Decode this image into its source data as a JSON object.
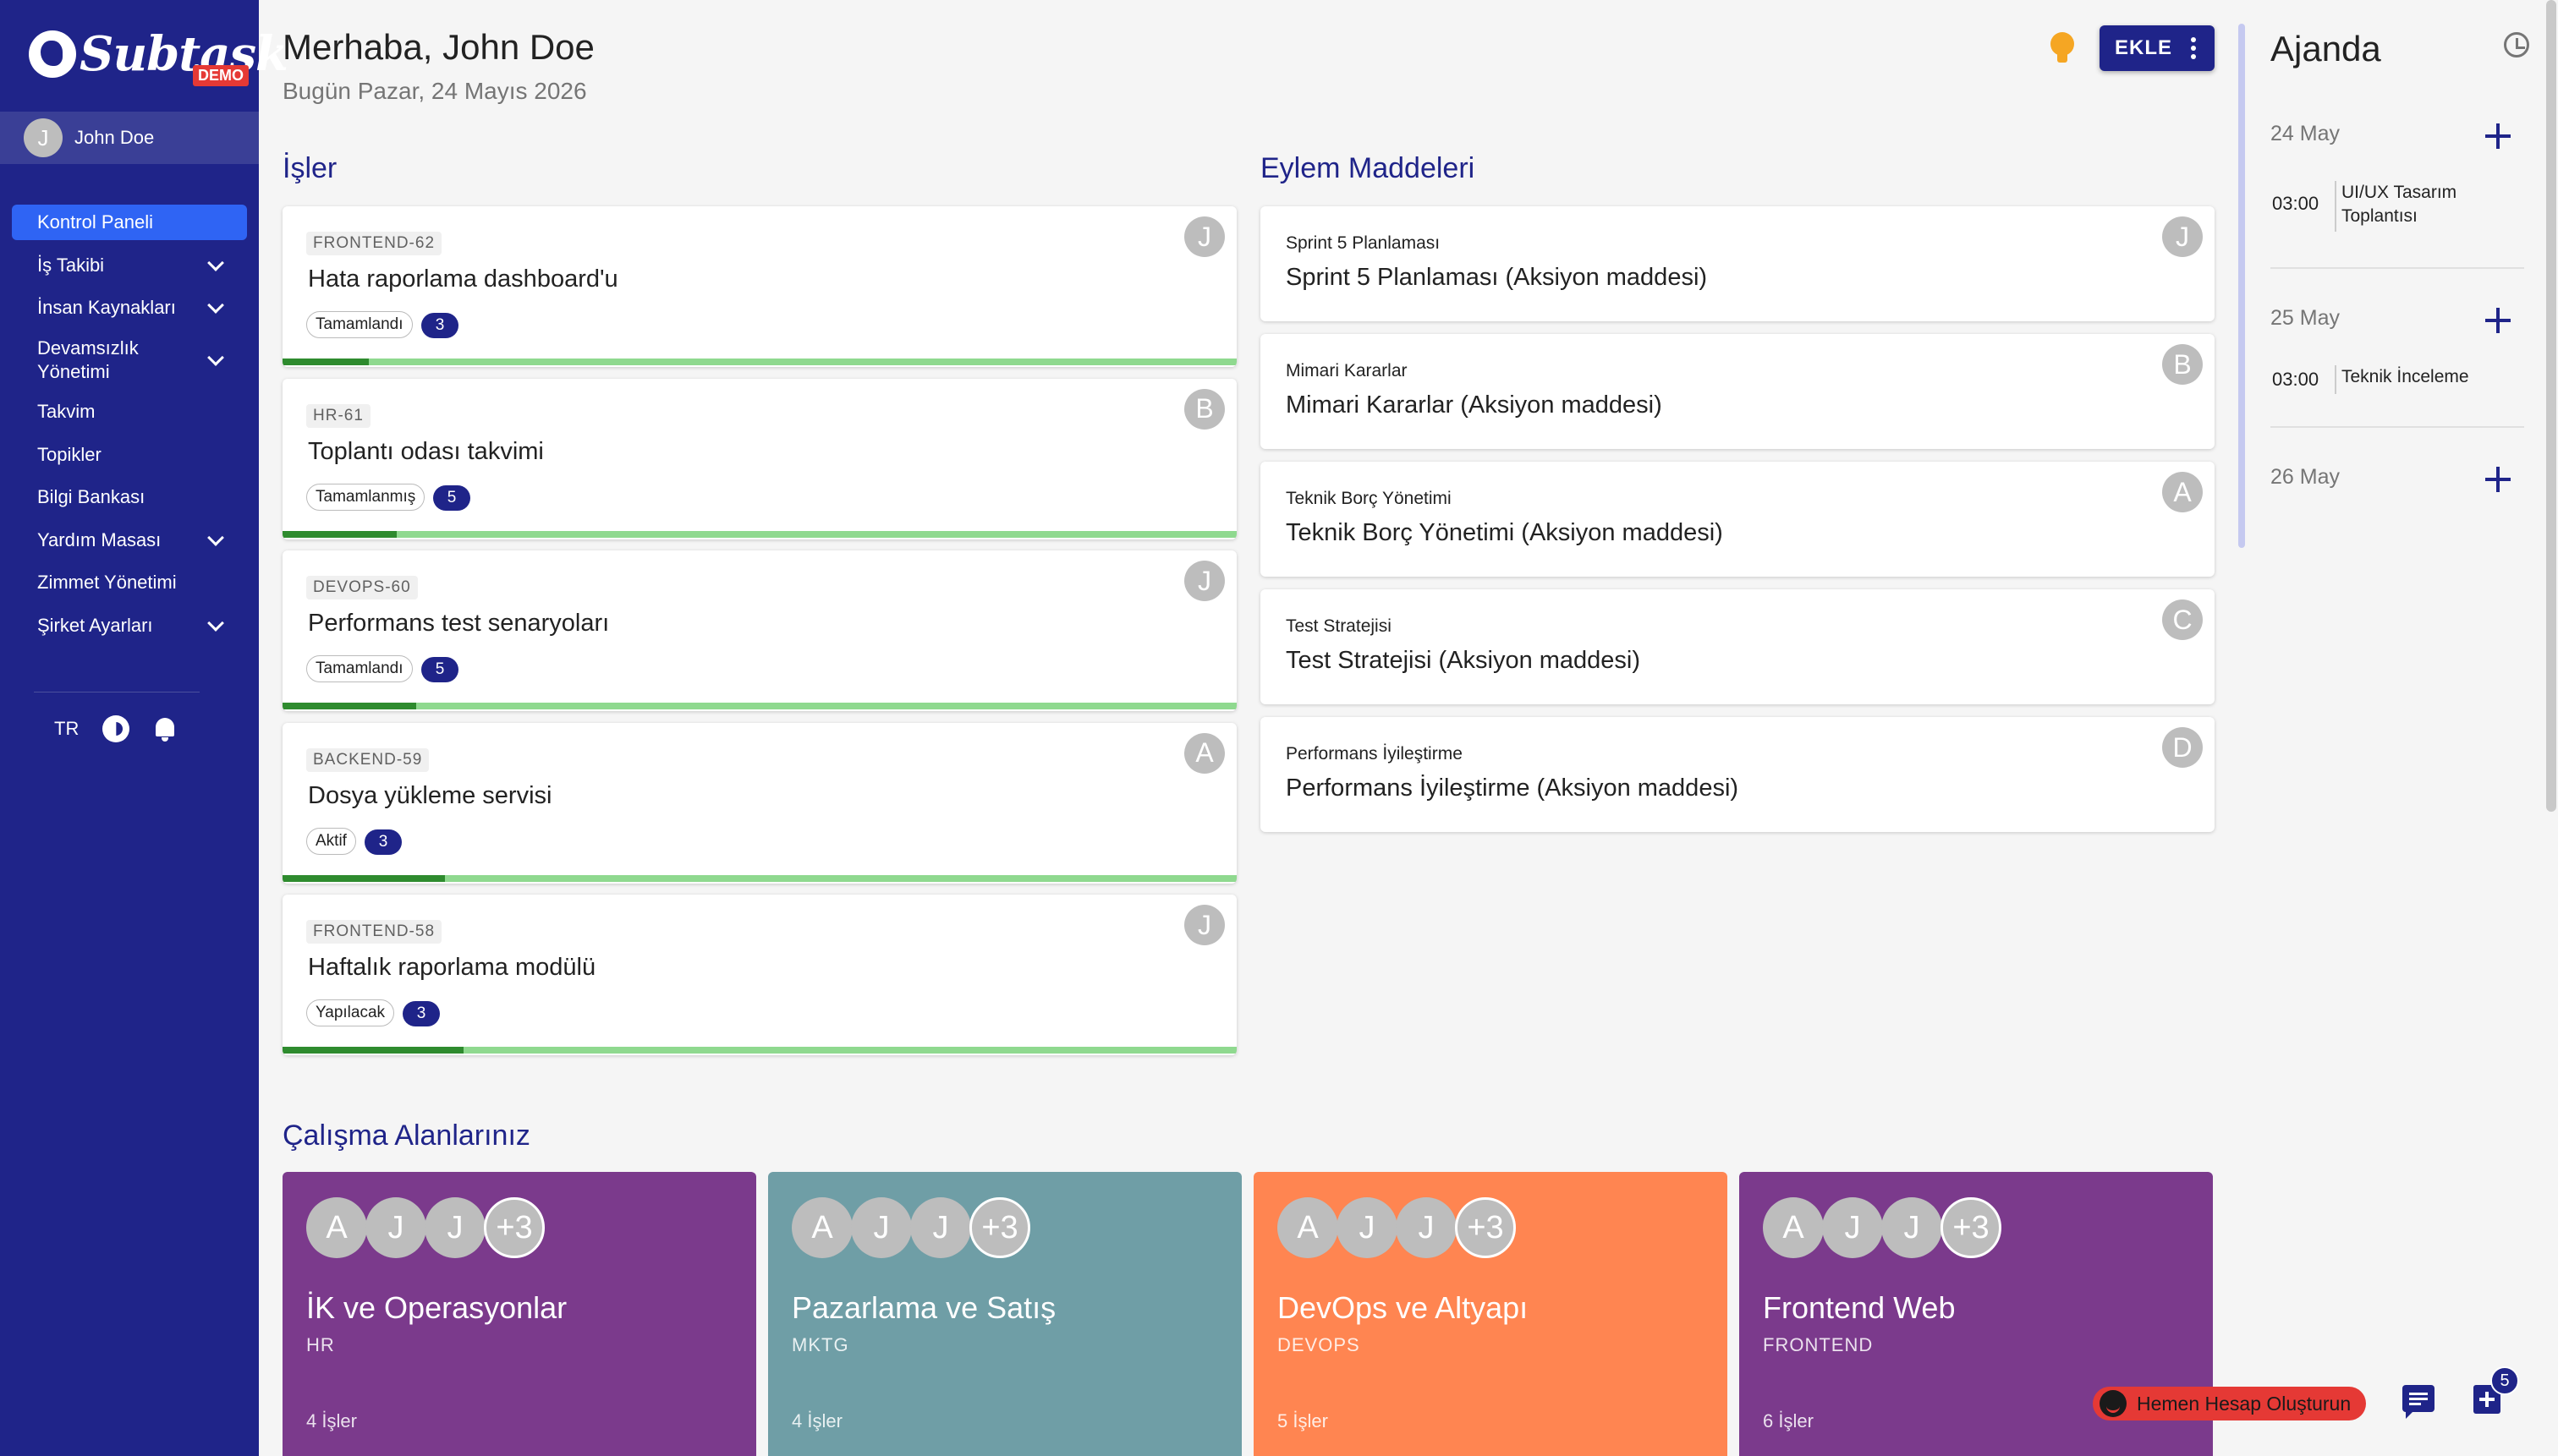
{
  "app": {
    "logo_text": "Subtask",
    "demo_badge": "DEMO"
  },
  "user": {
    "initial": "J",
    "name": "John Doe"
  },
  "sidebar": {
    "items": [
      {
        "label": "Kontrol Paneli",
        "active": true,
        "expandable": false
      },
      {
        "label": "İş Takibi",
        "expandable": true
      },
      {
        "label": "İnsan Kaynakları",
        "expandable": true
      },
      {
        "label": "Devamsızlık Yönetimi",
        "expandable": true
      },
      {
        "label": "Takvim",
        "expandable": false
      },
      {
        "label": "Topikler",
        "expandable": false
      },
      {
        "label": "Bilgi Bankası",
        "expandable": false
      },
      {
        "label": "Yardım Masası",
        "expandable": true
      },
      {
        "label": "Zimmet Yönetimi",
        "expandable": false
      },
      {
        "label": "Şirket Ayarları",
        "expandable": true
      }
    ],
    "language": "TR",
    "theme_icon": "brightness-icon",
    "notification_icon": "bell-icon"
  },
  "header": {
    "greeting": "Merhaba, John Doe",
    "date": "Bugün Pazar, 24 Mayıs 2026",
    "add_button": "EKLE",
    "tip_icon": "lightbulb-icon",
    "more_icon": "kebab-menu-icon"
  },
  "tasks": {
    "title": "İşler",
    "items": [
      {
        "code": "FRONTEND-62",
        "title": "Hata raporlama dashboard'u",
        "status": "Tamamlandı",
        "count": "3",
        "assignee": "J",
        "progress": 0.09
      },
      {
        "code": "HR-61",
        "title": "Toplantı odası takvimi",
        "status": "Tamamlanmış",
        "count": "5",
        "assignee": "B",
        "progress": 0.12
      },
      {
        "code": "DEVOPS-60",
        "title": "Performans test senaryoları",
        "status": "Tamamlandı",
        "count": "5",
        "assignee": "J",
        "progress": 0.14
      },
      {
        "code": "BACKEND-59",
        "title": "Dosya yükleme servisi",
        "status": "Aktif",
        "count": "3",
        "assignee": "A",
        "progress": 0.17
      },
      {
        "code": "FRONTEND-58",
        "title": "Haftalık raporlama modülü",
        "status": "Yapılacak",
        "count": "3",
        "assignee": "J",
        "progress": 0.19
      }
    ]
  },
  "actions": {
    "title": "Eylem Maddeleri",
    "items": [
      {
        "subtitle": "Sprint 5 Planlaması",
        "title": "Sprint 5 Planlaması (Aksiyon maddesi)",
        "assignee": "J"
      },
      {
        "subtitle": "Mimari Kararlar",
        "title": "Mimari Kararlar (Aksiyon maddesi)",
        "assignee": "B"
      },
      {
        "subtitle": "Teknik Borç Yönetimi",
        "title": "Teknik Borç Yönetimi (Aksiyon maddesi)",
        "assignee": "A"
      },
      {
        "subtitle": "Test Stratejisi",
        "title": "Test Stratejisi (Aksiyon maddesi)",
        "assignee": "C"
      },
      {
        "subtitle": "Performans İyileştirme",
        "title": "Performans İyileştirme (Aksiyon maddesi)",
        "assignee": "D"
      }
    ]
  },
  "workspaces": {
    "title": "Çalışma Alanlarınız",
    "items": [
      {
        "name": "İK ve Operasyonlar",
        "code": "HR",
        "jobs": "4 İşler",
        "color": "#7b3a8c",
        "members": [
          "A",
          "J",
          "J"
        ],
        "more": "+3"
      },
      {
        "name": "Pazarlama ve Satış",
        "code": "MKTG",
        "jobs": "4 İşler",
        "color": "#6f9ea6",
        "members": [
          "A",
          "J",
          "J"
        ],
        "more": "+3"
      },
      {
        "name": "DevOps ve Altyapı",
        "code": "DEVOPS",
        "jobs": "5 İşler",
        "color": "#ff8551",
        "members": [
          "A",
          "J",
          "J"
        ],
        "more": "+3"
      },
      {
        "name": "Frontend Web",
        "code": "FRONTEND",
        "jobs": "6 İşler",
        "color": "#7b3a8c",
        "members": [
          "A",
          "J",
          "J"
        ],
        "more": "+3"
      }
    ]
  },
  "agenda": {
    "title": "Ajanda",
    "history_icon": "history-icon",
    "days": [
      {
        "date": "24 May",
        "events": [
          {
            "time": "03:00",
            "title": "UI/UX Tasarım Toplantısı"
          }
        ]
      },
      {
        "date": "25 May",
        "events": [
          {
            "time": "03:00",
            "title": "Teknik İnceleme"
          }
        ]
      },
      {
        "date": "26 May",
        "events": []
      }
    ]
  },
  "footer": {
    "cta_label": "Hemen Hesap Oluşturun",
    "chat_icon": "chat-icon",
    "new_item_icon": "add-box-icon",
    "badge_count": "5"
  },
  "colors": {
    "brand": "#1f2489",
    "active_nav": "#2f64f4",
    "cta": "#e53935",
    "progress_fill": "#2e8b2e",
    "progress_track": "#8fd98f"
  }
}
